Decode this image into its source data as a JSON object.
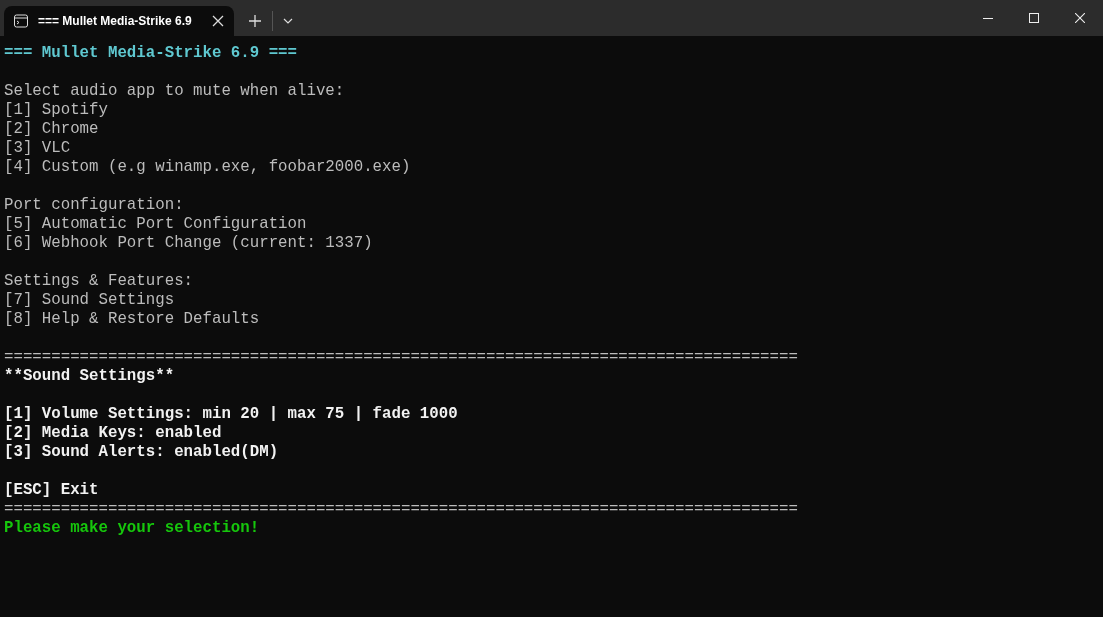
{
  "window": {
    "tabs": [
      {
        "title": "=== Mullet Media-Strike 6.9",
        "selected": true
      }
    ]
  },
  "terminal": {
    "lines": [
      {
        "kind": "title",
        "text": "=== Mullet Media-Strike 6.9 ==="
      },
      {
        "kind": "blank"
      },
      {
        "kind": "normal",
        "text": "Select audio app to mute when alive:"
      },
      {
        "kind": "normal",
        "text": "[1] Spotify"
      },
      {
        "kind": "normal",
        "text": "[2] Chrome"
      },
      {
        "kind": "normal",
        "text": "[3] VLC"
      },
      {
        "kind": "normal",
        "text": "[4] Custom (e.g winamp.exe, foobar2000.exe)"
      },
      {
        "kind": "blank"
      },
      {
        "kind": "normal",
        "text": "Port configuration:"
      },
      {
        "kind": "normal",
        "text": "[5] Automatic Port Configuration"
      },
      {
        "kind": "normal",
        "text": "[6] Webhook Port Change (current: 1337)"
      },
      {
        "kind": "blank"
      },
      {
        "kind": "normal",
        "text": "Settings & Features:"
      },
      {
        "kind": "normal",
        "text": "[7] Sound Settings"
      },
      {
        "kind": "normal",
        "text": "[8] Help & Restore Defaults"
      },
      {
        "kind": "blank"
      },
      {
        "kind": "separator",
        "text": "===================================================================================="
      },
      {
        "kind": "bright",
        "text": "**Sound Settings**"
      },
      {
        "kind": "blank"
      },
      {
        "kind": "bright",
        "text": "[1] Volume Settings: min 20 | max 75 | fade 1000"
      },
      {
        "kind": "bright",
        "text": "[2] Media Keys: enabled"
      },
      {
        "kind": "bright",
        "text": "[3] Sound Alerts: enabled(DM)"
      },
      {
        "kind": "blank"
      },
      {
        "kind": "bright",
        "text": "[ESC] Exit"
      },
      {
        "kind": "separator",
        "text": "===================================================================================="
      },
      {
        "kind": "success",
        "text": "Please make your selection!"
      }
    ]
  }
}
